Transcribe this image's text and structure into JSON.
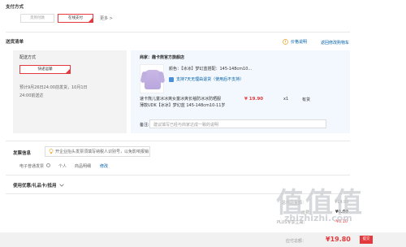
{
  "payment": {
    "title": "支付方式",
    "options": [
      "货到付款",
      "在线支付"
    ],
    "more": "更多 >"
  },
  "delivery": {
    "title": "送货清单",
    "price_note": "价格说明",
    "return_cart": "返回修改购物车",
    "method_label": "配送方式",
    "method_value": "快递运输",
    "eta_line1": "预计9月26日24:00前发货，10月1日",
    "eta_line2": "24:00前送达"
  },
  "shop": {
    "label": "商家：",
    "name": "趣卡熊官方旗舰店"
  },
  "product": {
    "color_line": "颜色：【冰冰】梦幻蓝搭配：145-148cm10...",
    "support": "支持7天无理由退货（使用后不支持）",
    "title_line1": "速卡熊儿童冰冰爽女童冰爽长袖防冰冰防晒服",
    "title_line2": "薄款UDK【冰冰】梦幻蓝 145-148cm10-11岁",
    "price": "¥ 19.90",
    "qty": "x1",
    "stock": "有货"
  },
  "remark": {
    "label": "备注:",
    "placeholder": "建议填写已经与商家达成一致的说明"
  },
  "invoice": {
    "title": "发票信息",
    "tip": "开企业抬头发票须填写纳税人识别号，以免影响报销",
    "type": "电子普通发票",
    "personal": "个人",
    "detail": "商品明细",
    "edit": "修改"
  },
  "coupon": {
    "title": "使用优惠/礼品卡/抵用"
  },
  "summary": {
    "row1_label": "总商品金额：",
    "row1_value": "¥19.90",
    "row2_label": "运费：",
    "row2_value": "¥0.00",
    "row3_label": "PLUS专享立减：",
    "row3_value": "-¥0.10",
    "total_label": "应付总额：",
    "total_value": "¥19.80",
    "submit": "提交"
  },
  "watermark": {
    "brand": "值值值",
    "url": "zhizhizhi.com"
  },
  "colors": {
    "accent": "#e4393c",
    "link": "#005ea7",
    "panel": "#f3f8fe"
  }
}
